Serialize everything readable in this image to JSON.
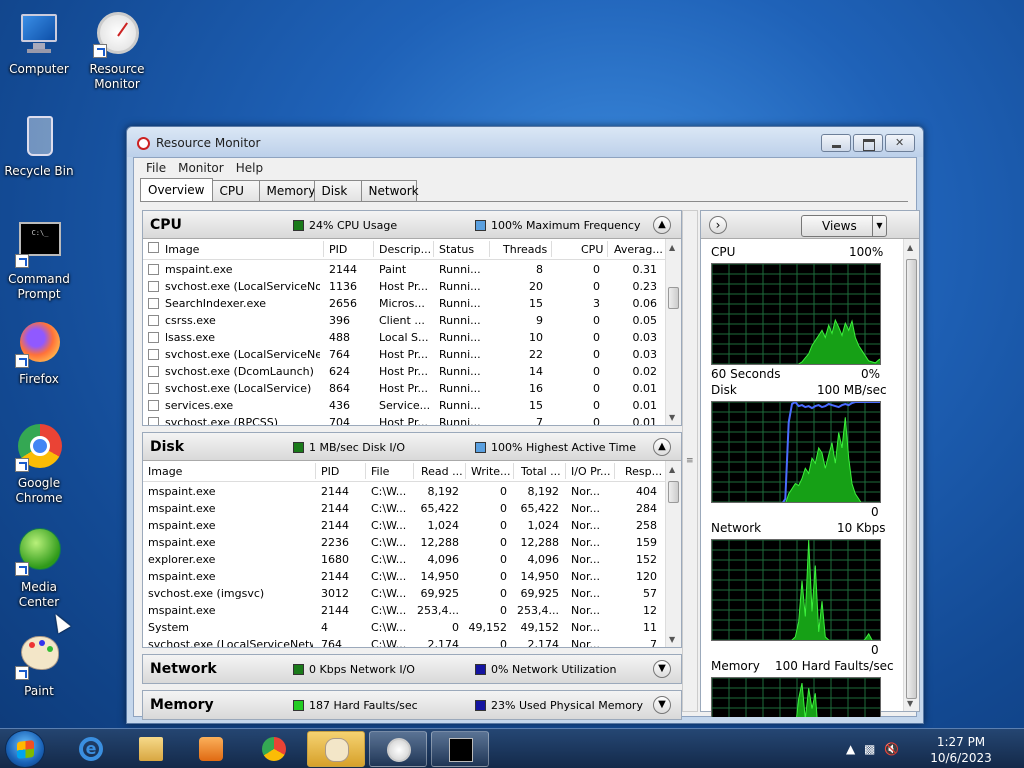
{
  "desktop": {
    "icons": [
      {
        "label": "Computer"
      },
      {
        "label": "Resource Monitor"
      },
      {
        "label": "Recycle Bin"
      },
      {
        "label": "Command Prompt"
      },
      {
        "label": "Firefox"
      },
      {
        "label": "Google Chrome"
      },
      {
        "label": "Media Center"
      },
      {
        "label": "Paint"
      }
    ]
  },
  "window": {
    "title": "Resource Monitor",
    "menu": [
      "File",
      "Monitor",
      "Help"
    ],
    "tabs": [
      "Overview",
      "CPU",
      "Memory",
      "Disk",
      "Network"
    ],
    "active_tab": "Overview"
  },
  "cpu": {
    "name": "CPU",
    "ind1": "24% CPU Usage",
    "ind1_color": "#1a7a1a",
    "ind2": "100% Maximum Frequency",
    "ind2_color": "#5aa0e0",
    "columns": [
      "Image",
      "PID",
      "Descrip...",
      "Status",
      "Threads",
      "CPU",
      "Averag..."
    ],
    "rows": [
      [
        "mspaint.exe",
        "2144",
        "Paint",
        "Runni...",
        "8",
        "0",
        "0.31"
      ],
      [
        "svchost.exe (LocalServiceNo...",
        "1136",
        "Host Pr...",
        "Runni...",
        "20",
        "0",
        "0.23"
      ],
      [
        "SearchIndexer.exe",
        "2656",
        "Micros...",
        "Runni...",
        "15",
        "3",
        "0.06"
      ],
      [
        "csrss.exe",
        "396",
        "Client ...",
        "Runni...",
        "9",
        "0",
        "0.05"
      ],
      [
        "lsass.exe",
        "488",
        "Local S...",
        "Runni...",
        "10",
        "0",
        "0.03"
      ],
      [
        "svchost.exe (LocalServiceNet...",
        "764",
        "Host Pr...",
        "Runni...",
        "22",
        "0",
        "0.03"
      ],
      [
        "svchost.exe (DcomLaunch)",
        "624",
        "Host Pr...",
        "Runni...",
        "14",
        "0",
        "0.02"
      ],
      [
        "svchost.exe (LocalService)",
        "864",
        "Host Pr...",
        "Runni...",
        "16",
        "0",
        "0.01"
      ],
      [
        "services.exe",
        "436",
        "Service...",
        "Runni...",
        "15",
        "0",
        "0.01"
      ],
      [
        "svchost.exe (RPCSS)",
        "704",
        "Host Pr...",
        "Runni...",
        "7",
        "0",
        "0.01"
      ]
    ]
  },
  "disk": {
    "name": "Disk",
    "ind1": "1 MB/sec Disk I/O",
    "ind1_color": "#1a7a1a",
    "ind2": "100% Highest Active Time",
    "ind2_color": "#5aa0e0",
    "columns": [
      "Image",
      "PID",
      "File",
      "Read ...",
      "Write...",
      "Total ...",
      "I/O Pr...",
      "Resp..."
    ],
    "rows": [
      [
        "mspaint.exe",
        "2144",
        "C:\\W...",
        "8,192",
        "0",
        "8,192",
        "Nor...",
        "404"
      ],
      [
        "mspaint.exe",
        "2144",
        "C:\\W...",
        "65,422",
        "0",
        "65,422",
        "Nor...",
        "284"
      ],
      [
        "mspaint.exe",
        "2144",
        "C:\\W...",
        "1,024",
        "0",
        "1,024",
        "Nor...",
        "258"
      ],
      [
        "mspaint.exe",
        "2236",
        "C:\\W...",
        "12,288",
        "0",
        "12,288",
        "Nor...",
        "159"
      ],
      [
        "explorer.exe",
        "1680",
        "C:\\W...",
        "4,096",
        "0",
        "4,096",
        "Nor...",
        "152"
      ],
      [
        "mspaint.exe",
        "2144",
        "C:\\W...",
        "14,950",
        "0",
        "14,950",
        "Nor...",
        "120"
      ],
      [
        "svchost.exe (imgsvc)",
        "3012",
        "C:\\W...",
        "69,925",
        "0",
        "69,925",
        "Nor...",
        "57"
      ],
      [
        "mspaint.exe",
        "2144",
        "C:\\W...",
        "253,4...",
        "0",
        "253,4...",
        "Nor...",
        "12"
      ],
      [
        "System",
        "4",
        "C:\\W...",
        "0",
        "49,152",
        "49,152",
        "Nor...",
        "11"
      ],
      [
        "svchost.exe (LocalServiceNetw...",
        "764",
        "C:\\W...",
        "2,174",
        "0",
        "2,174",
        "Nor...",
        "7"
      ]
    ]
  },
  "network": {
    "name": "Network",
    "ind1": "0 Kbps Network I/O",
    "ind1_color": "#1a7a1a",
    "ind2": "0% Network Utilization",
    "ind2_color": "#1414a0"
  },
  "memory": {
    "name": "Memory",
    "ind1": "187 Hard Faults/sec",
    "ind1_color": "#22cc22",
    "ind2": "23% Used Physical Memory",
    "ind2_color": "#1414a0"
  },
  "right_panel": {
    "views_label": "Views",
    "graphs": [
      {
        "name": "CPU",
        "max": "100%",
        "footer_left": "60 Seconds",
        "footer_right": "0%",
        "samples": [
          0,
          0,
          0,
          0,
          0,
          0,
          0,
          0,
          0,
          0,
          0,
          0,
          0,
          0,
          0,
          0,
          0,
          0,
          0,
          0,
          0,
          0,
          0,
          0,
          0,
          0,
          2,
          4,
          8,
          12,
          20,
          25,
          30,
          35,
          28,
          40,
          32,
          45,
          38,
          30,
          42,
          35,
          44,
          28,
          20,
          15,
          10,
          5,
          4,
          3,
          6,
          8
        ]
      },
      {
        "name": "Disk",
        "max": "100 MB/sec",
        "footer_left": "",
        "footer_right": "0",
        "samples": [
          0,
          0,
          0,
          0,
          0,
          0,
          0,
          0,
          0,
          0,
          0,
          0,
          0,
          0,
          0,
          0,
          0,
          0,
          0,
          0,
          0,
          0,
          0,
          10,
          15,
          20,
          18,
          25,
          35,
          30,
          45,
          40,
          55,
          50,
          35,
          48,
          60,
          40,
          70,
          55,
          85,
          45,
          20,
          10,
          5,
          0,
          0,
          0,
          0,
          0,
          0,
          0
        ],
        "line": [
          0,
          0,
          0,
          0,
          0,
          0,
          0,
          0,
          0,
          0,
          0,
          0,
          0,
          0,
          0,
          0,
          0,
          0,
          0,
          0,
          0,
          0,
          5,
          80,
          98,
          100,
          96,
          97,
          95,
          96,
          94,
          96,
          97,
          95,
          96,
          98,
          97,
          96,
          95,
          97,
          98,
          97,
          99,
          100,
          100,
          100,
          100,
          100,
          100,
          100,
          100,
          100
        ]
      },
      {
        "name": "Network",
        "max": "10 Kbps",
        "footer_left": "",
        "footer_right": "0",
        "samples": [
          0,
          0,
          0,
          0,
          0,
          0,
          0,
          0,
          0,
          0,
          0,
          0,
          0,
          0,
          0,
          0,
          0,
          0,
          0,
          0,
          0,
          0,
          0,
          0,
          2,
          5,
          20,
          60,
          25,
          100,
          30,
          75,
          10,
          40,
          5,
          2,
          0,
          0,
          0,
          0,
          0,
          0,
          0,
          0,
          0,
          0,
          3,
          8,
          2,
          0,
          0,
          0
        ]
      },
      {
        "name": "Memory",
        "max": "100 Hard Faults/sec",
        "footer_left": "",
        "footer_right": "",
        "samples": [
          0,
          0,
          0,
          0,
          0,
          0,
          0,
          0,
          0,
          0,
          0,
          0,
          0,
          0,
          0,
          0,
          0,
          0,
          0,
          0,
          0,
          0,
          0,
          0,
          20,
          50,
          80,
          95,
          60,
          90,
          70,
          85,
          40,
          60,
          30,
          20,
          10,
          5,
          0,
          0,
          0,
          0,
          0,
          0,
          0,
          0,
          0,
          0,
          0,
          0,
          0,
          0
        ]
      }
    ]
  },
  "taskbar": {
    "time": "1:27 PM",
    "date": "10/6/2023"
  }
}
